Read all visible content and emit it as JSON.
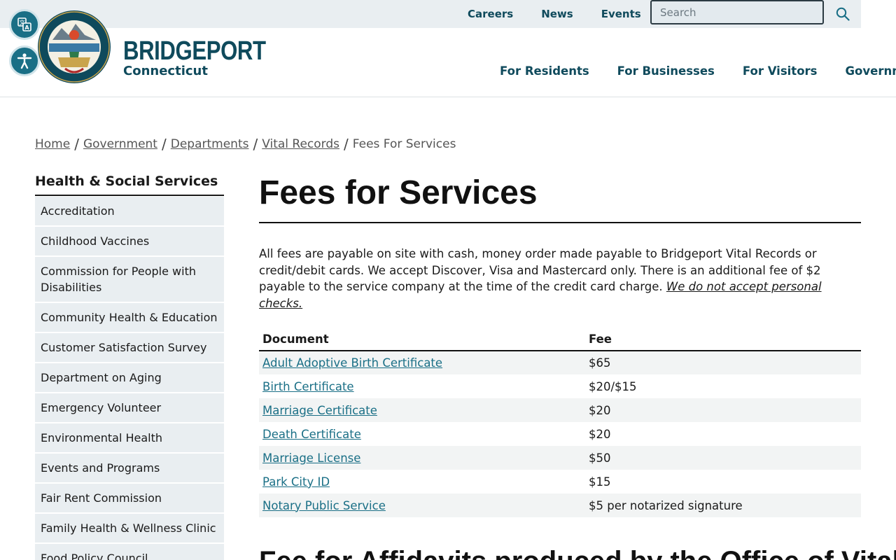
{
  "utility": {
    "links": [
      "Careers",
      "News",
      "Events"
    ],
    "search_placeholder": "Search"
  },
  "brand": {
    "name": "BRIDGEPORT",
    "subtitle": "Connecticut"
  },
  "nav": {
    "items": [
      "For Residents",
      "For Businesses",
      "For Visitors",
      "Government"
    ]
  },
  "breadcrumb": {
    "items": [
      "Home",
      "Government",
      "Departments",
      "Vital Records"
    ],
    "current": "Fees For Services"
  },
  "sidebar": {
    "title": "Health & Social Services",
    "items": [
      "Accreditation",
      "Childhood Vaccines",
      "Commission for People with Disabilities",
      "Community Health & Education",
      "Customer Satisfaction Survey",
      "Department on Aging",
      "Emergency Volunteer",
      "Environmental Health",
      "Events and Programs",
      "Fair Rent Commission",
      "Family Health & Wellness Clinic",
      "Food Policy Council"
    ]
  },
  "main": {
    "title": "Fees for Services",
    "intro": "All fees are payable on site with cash, money order made payable to Bridgeport Vital Records or credit/debit cards. We accept Discover, Visa and Mastercard only. There is an additional fee of $2 payable to the service company at the time of the credit card charge.",
    "intro_link": "We do not accept personal checks.",
    "table": {
      "headers": [
        "Document",
        "Fee"
      ],
      "rows": [
        {
          "document": "Adult Adoptive Birth Certificate",
          "fee": "$65"
        },
        {
          "document": "Birth Certificate",
          "fee": "$20/$15"
        },
        {
          "document": "Marriage Certificate",
          "fee": "$20"
        },
        {
          "document": "Death Certificate",
          "fee": "$20"
        },
        {
          "document": "Marriage License",
          "fee": "$50"
        },
        {
          "document": "Park City ID",
          "fee": "$15"
        },
        {
          "document": "Notary Public Service",
          "fee": "$5 per notarized signature"
        }
      ]
    },
    "section2_title": "Fee for Affidavits produced by the Office of Vital"
  },
  "colors": {
    "brand": "#0f4a5c",
    "link": "#1a6f86",
    "panel": "#e9eef1"
  },
  "icons": [
    "translate-icon",
    "accessibility-icon",
    "city-seal-logo",
    "search-icon"
  ]
}
